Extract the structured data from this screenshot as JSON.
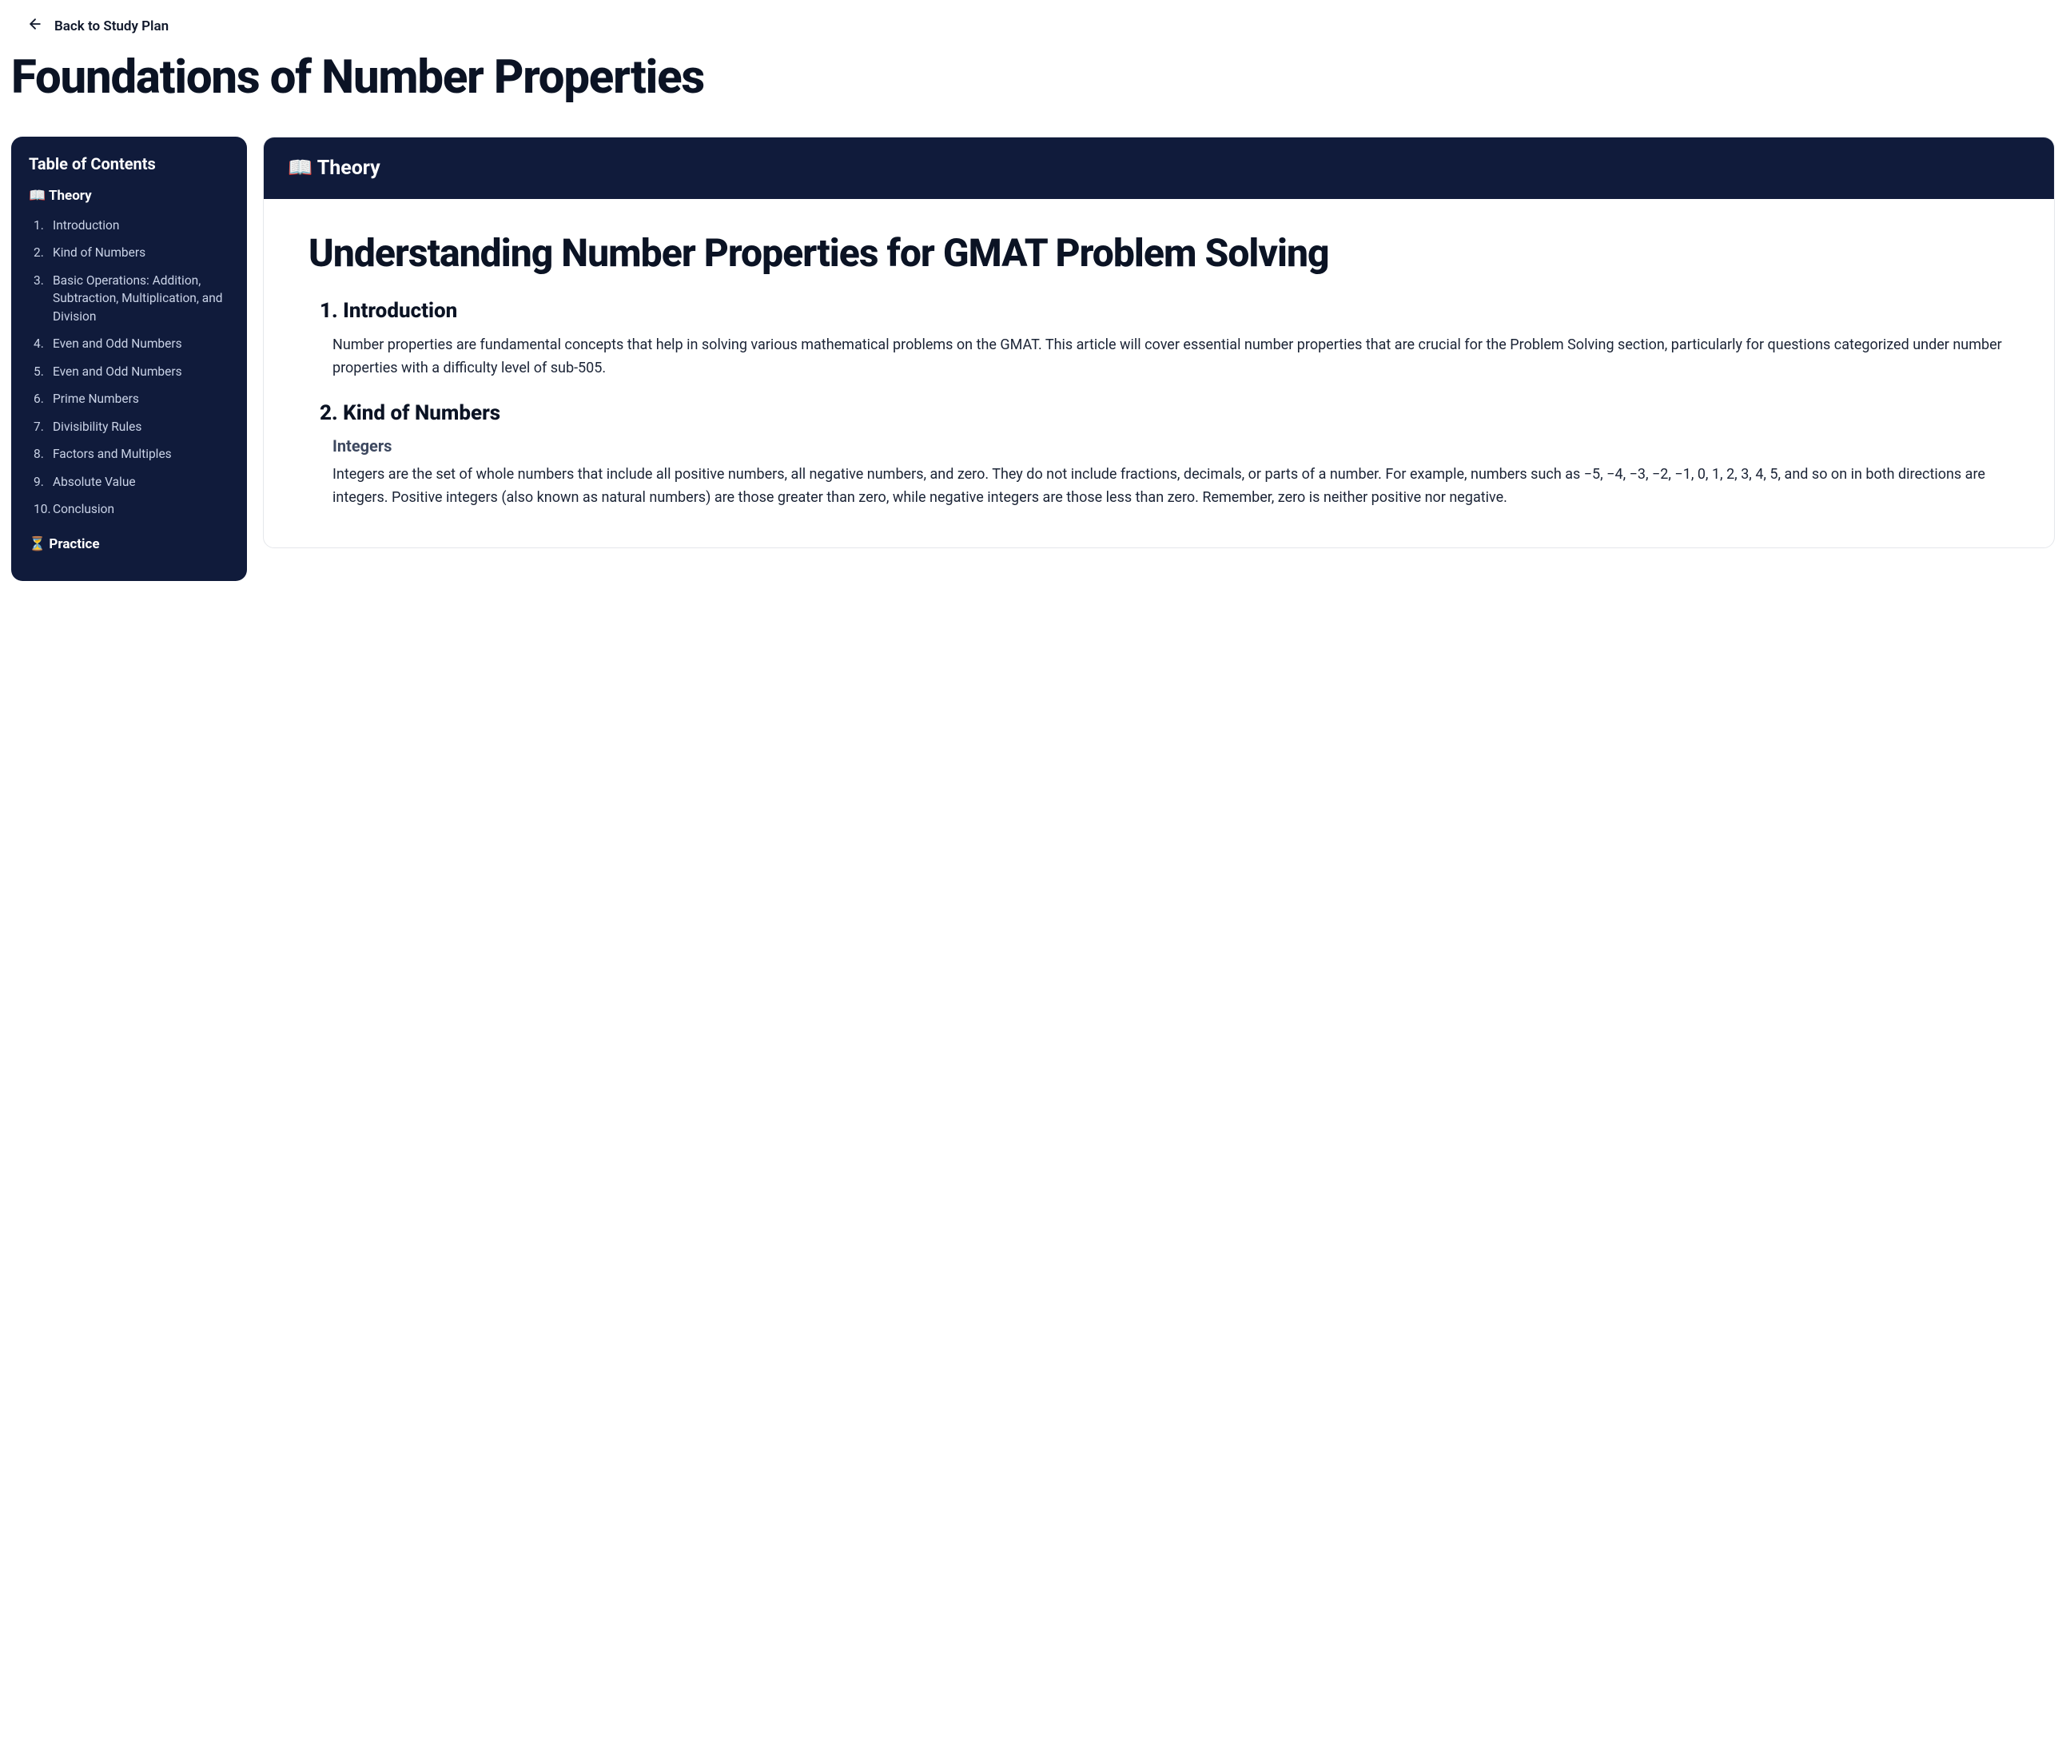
{
  "back_link": "Back to Study Plan",
  "page_title": "Foundations of Number Properties",
  "toc": {
    "title": "Table of Contents",
    "theory_icon": "📖",
    "theory_label": "Theory",
    "practice_icon": "⏳",
    "practice_label": "Practice",
    "items": [
      "Introduction",
      "Kind of Numbers",
      "Basic Operations: Addition, Subtraction, Multiplication, and Division",
      "Even and Odd Numbers",
      "Even and Odd Numbers",
      "Prime Numbers",
      "Divisibility Rules",
      "Factors and Multiples",
      "Absolute Value",
      "Conclusion"
    ]
  },
  "content": {
    "header_icon": "📖",
    "header_label": "Theory",
    "article_title": "Understanding Number Properties for GMAT Problem Solving",
    "sections": {
      "s1": {
        "heading": "1. Introduction",
        "body": "Number properties are fundamental concepts that help in solving various mathematical problems on the GMAT. This article will cover essential number properties that are crucial for the Problem Solving section, particularly for questions categorized under number properties with a difficulty level of sub-505."
      },
      "s2": {
        "heading": "2. Kind of Numbers",
        "sub_heading": "Integers",
        "body": "Integers are the set of whole numbers that include all positive numbers, all negative numbers, and zero. They do not include fractions, decimals, or parts of a number. For example, numbers such as −5, −4, −3, −2, −1, 0, 1, 2, 3, 4, 5, and so on in both directions are integers. Positive integers (also known as natural numbers) are those greater than zero, while negative integers are those less than zero. Remember, zero is neither positive nor negative."
      }
    }
  }
}
